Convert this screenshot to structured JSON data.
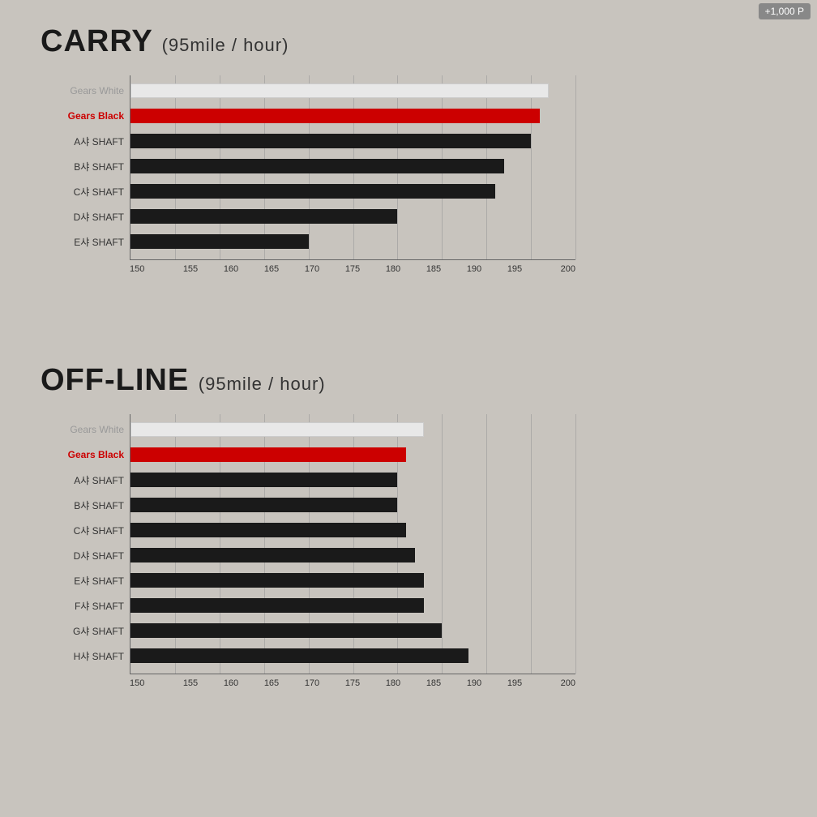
{
  "badge": "+1,000 P",
  "carry": {
    "title": "CARRY",
    "subtitle": "(95mile / hour)",
    "xMin": 150,
    "xMax": 200,
    "xStep": 5,
    "xLabels": [
      "150",
      "155",
      "160",
      "165",
      "170",
      "175",
      "180",
      "185",
      "190",
      "195",
      "200"
    ],
    "bars": [
      {
        "label": "Gears White",
        "labelClass": "white-label",
        "barClass": "white-bar",
        "value": 197,
        "pct": 94
      },
      {
        "label": "Gears Black",
        "labelClass": "red-label",
        "barClass": "red-bar",
        "value": 196,
        "pct": 92
      },
      {
        "label": "A샤 SHAFT",
        "labelClass": "",
        "barClass": "black-bar",
        "value": 195,
        "pct": 90
      },
      {
        "label": "B샤 SHAFT",
        "labelClass": "",
        "barClass": "black-bar",
        "value": 192,
        "pct": 84
      },
      {
        "label": "C샤 SHAFT",
        "labelClass": "",
        "barClass": "black-bar",
        "value": 191,
        "pct": 82
      },
      {
        "label": "D샤 SHAFT",
        "labelClass": "",
        "barClass": "black-bar",
        "value": 180,
        "pct": 60
      },
      {
        "label": "E샤 SHAFT",
        "labelClass": "",
        "barClass": "black-bar",
        "value": 170,
        "pct": 40
      }
    ]
  },
  "offline": {
    "title": "OFF-LINE",
    "subtitle": "(95mile / hour)",
    "xMin": 150,
    "xMax": 200,
    "xStep": 5,
    "xLabels": [
      "150",
      "155",
      "160",
      "165",
      "170",
      "175",
      "180",
      "185",
      "190",
      "195",
      "200"
    ],
    "bars": [
      {
        "label": "Gears White",
        "labelClass": "white-label",
        "barClass": "white-bar",
        "value": 183,
        "pct": 66
      },
      {
        "label": "Gears Black",
        "labelClass": "red-label",
        "barClass": "red-bar",
        "value": 181,
        "pct": 62
      },
      {
        "label": "A샤 SHAFT",
        "labelClass": "",
        "barClass": "black-bar",
        "value": 180,
        "pct": 60
      },
      {
        "label": "B샤 SHAFT",
        "labelClass": "",
        "barClass": "black-bar",
        "value": 180,
        "pct": 60
      },
      {
        "label": "C샤 SHAFT",
        "labelClass": "",
        "barClass": "black-bar",
        "value": 181,
        "pct": 62
      },
      {
        "label": "D샤 SHAFT",
        "labelClass": "",
        "barClass": "black-bar",
        "value": 182,
        "pct": 64
      },
      {
        "label": "E샤 SHAFT",
        "labelClass": "",
        "barClass": "black-bar",
        "value": 183,
        "pct": 66
      },
      {
        "label": "F샤 SHAFT",
        "labelClass": "",
        "barClass": "black-bar",
        "value": 183,
        "pct": 66
      },
      {
        "label": "G샤 SHAFT",
        "labelClass": "",
        "barClass": "black-bar",
        "value": 185,
        "pct": 70
      },
      {
        "label": "H샤 SHAFT",
        "labelClass": "",
        "barClass": "black-bar",
        "value": 188,
        "pct": 76
      }
    ]
  }
}
